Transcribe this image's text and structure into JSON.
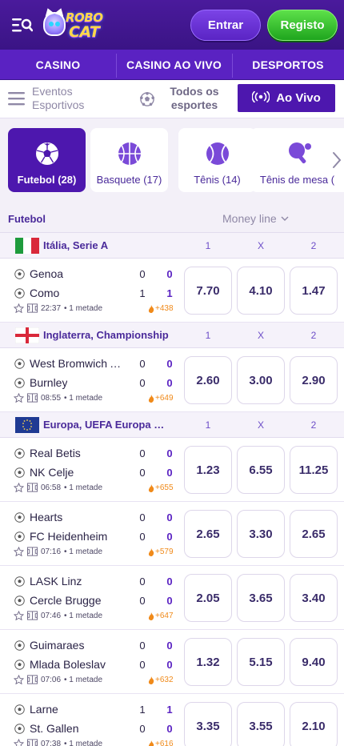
{
  "header": {
    "logo_text_top": "ROBO",
    "logo_text_bottom": "CAT",
    "login_label": "Entrar",
    "register_label": "Registo"
  },
  "topnav": [
    "CASINO",
    "CASINO AO VIVO",
    "DESPORTOS"
  ],
  "eventbar": {
    "events_line1": "Eventos",
    "events_line2": "Esportivos",
    "all_line1": "Todos os",
    "all_line2": "esportes",
    "live_label": "Ao Vivo"
  },
  "sports": [
    {
      "label": "Futebol (28)",
      "icon": "soccer-ball-icon",
      "active": true
    },
    {
      "label": "Basquete (17)",
      "icon": "basketball-icon",
      "active": false
    },
    {
      "label": "Tênis (14)",
      "icon": "tennis-ball-icon",
      "active": false
    },
    {
      "label": "Tênis de mesa (",
      "icon": "table-tennis-icon",
      "active": false
    }
  ],
  "table": {
    "section_title": "Futebol",
    "market": "Money line",
    "col1": "1",
    "colx": "X",
    "col2": "2"
  },
  "leagues": [
    {
      "name": "Itália, Serie A",
      "flag": "italy",
      "matches": [
        {
          "team1": "Genoa",
          "team2": "Como",
          "s1a": "0",
          "s1b": "0",
          "s2a": "1",
          "s2b": "1",
          "time": "22:37",
          "period": "• 1 metade",
          "markets": "+438",
          "odd1": "7.70",
          "oddx": "4.10",
          "odd2": "1.47"
        }
      ]
    },
    {
      "name": "Inglaterra, Championship",
      "flag": "england",
      "matches": [
        {
          "team1": "West Bromwich Albion",
          "team2": "Burnley",
          "s1a": "0",
          "s1b": "0",
          "s2a": "0",
          "s2b": "0",
          "time": "08:55",
          "period": "• 1 metade",
          "markets": "+649",
          "odd1": "2.60",
          "oddx": "3.00",
          "odd2": "2.90"
        }
      ]
    },
    {
      "name": "Europa, UEFA Europa Conference League",
      "flag": "europe",
      "matches": [
        {
          "team1": "Real Betis",
          "team2": "NK Celje",
          "s1a": "0",
          "s1b": "0",
          "s2a": "0",
          "s2b": "0",
          "time": "06:58",
          "period": "• 1 metade",
          "markets": "+655",
          "odd1": "1.23",
          "oddx": "6.55",
          "odd2": "11.25"
        },
        {
          "team1": "Hearts",
          "team2": "FC Heidenheim",
          "s1a": "0",
          "s1b": "0",
          "s2a": "0",
          "s2b": "0",
          "time": "07:16",
          "period": "• 1 metade",
          "markets": "+579",
          "odd1": "2.65",
          "oddx": "3.30",
          "odd2": "2.65"
        },
        {
          "team1": "LASK Linz",
          "team2": "Cercle Brugge",
          "s1a": "0",
          "s1b": "0",
          "s2a": "0",
          "s2b": "0",
          "time": "07:46",
          "period": "• 1 metade",
          "markets": "+647",
          "odd1": "2.05",
          "oddx": "3.65",
          "odd2": "3.40"
        },
        {
          "team1": "Guimaraes",
          "team2": "Mlada Boleslav",
          "s1a": "0",
          "s1b": "0",
          "s2a": "0",
          "s2b": "0",
          "time": "07:06",
          "period": "• 1 metade",
          "markets": "+632",
          "odd1": "1.32",
          "oddx": "5.15",
          "odd2": "9.40"
        },
        {
          "team1": "Larne",
          "team2": "St. Gallen",
          "s1a": "1",
          "s1b": "1",
          "s2a": "0",
          "s2b": "0",
          "time": "07:38",
          "period": "• 1 metade",
          "markets": "+616",
          "odd1": "3.35",
          "oddx": "3.55",
          "odd2": "2.10"
        }
      ]
    }
  ],
  "colors": {
    "brand_purple": "#4d17ae",
    "header_purple": "#4a1a9c",
    "register_green": "#2fbf2a",
    "accent_orange": "#f08a1a"
  }
}
